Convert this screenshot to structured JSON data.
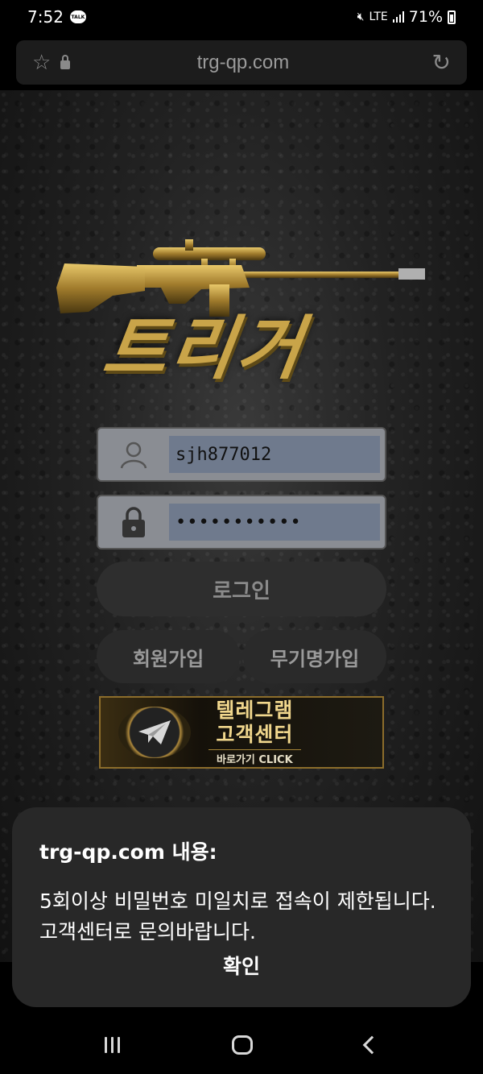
{
  "status_bar": {
    "time": "7:52",
    "talk_badge": "TALK",
    "network": "LTE",
    "battery": "71%"
  },
  "browser": {
    "url": "trg-qp.com"
  },
  "logo": {
    "text": "트리거"
  },
  "login_form": {
    "username": "sjh877012",
    "password": "•••••••••••",
    "login_label": "로그인",
    "join_label": "회원가입",
    "anon_join_label": "무기명가입"
  },
  "telegram_banner": {
    "line1": "텔레그램",
    "line2": "고객센터",
    "line3": "바로가기 CLICK"
  },
  "dialog": {
    "title": "trg-qp.com 내용:",
    "message": "5회이상 비밀번호 미일치로 접속이 제한됩니다. 고객센터로 문의바랍니다.",
    "confirm_label": "확인"
  }
}
